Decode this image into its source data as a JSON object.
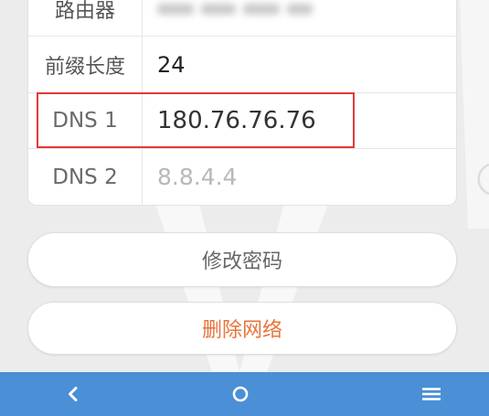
{
  "details": {
    "router_label": "路由器",
    "prefix_length_label": "前缀长度",
    "prefix_length_value": "24",
    "dns1_label": "DNS 1",
    "dns1_value": "180.76.76.76",
    "dns2_label": "DNS 2",
    "dns2_hint": "8.8.4.4"
  },
  "actions": {
    "change_password_label": "修改密码",
    "delete_network_label": "删除网络"
  },
  "navigation_bar": {
    "icons": [
      "back-icon",
      "home-icon",
      "menu-icon"
    ]
  },
  "colors": {
    "nav_bar": "#4b8fd6",
    "delete_text": "#e8743a",
    "highlight_border": "#e03a3a"
  }
}
